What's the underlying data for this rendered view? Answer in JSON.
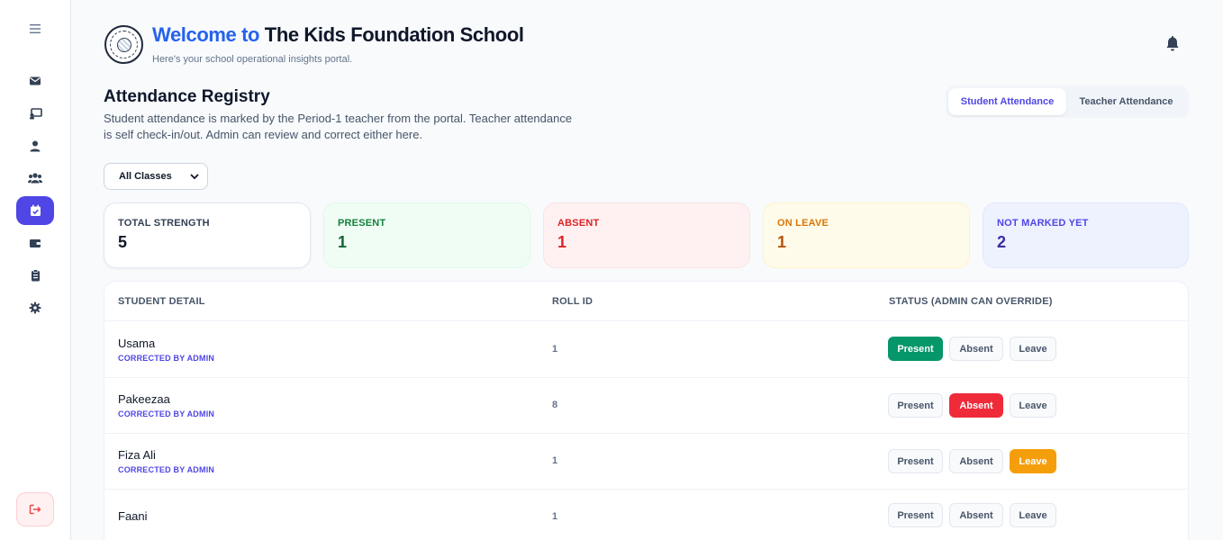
{
  "header": {
    "title_prefix": "Welcome to",
    "title_school": "The Kids Foundation School",
    "subtitle": "Here's your school operational insights portal."
  },
  "sidebar": {
    "items": [
      {
        "icon": "envelope-icon",
        "active": false
      },
      {
        "icon": "chalkboard-icon",
        "active": false
      },
      {
        "icon": "user-icon",
        "active": false
      },
      {
        "icon": "users-icon",
        "active": false
      },
      {
        "icon": "calendar-check-icon",
        "active": true
      },
      {
        "icon": "wallet-icon",
        "active": false
      },
      {
        "icon": "clipboard-icon",
        "active": false
      },
      {
        "icon": "gear-icon",
        "active": false
      }
    ]
  },
  "registry": {
    "title": "Attendance Registry",
    "description": "Student attendance is marked by the Period-1 teacher from the portal. Teacher attendance is self check-in/out. Admin can review and correct either here."
  },
  "tabs": [
    {
      "label": "Student Attendance",
      "active": true
    },
    {
      "label": "Teacher Attendance",
      "active": false
    }
  ],
  "filter": {
    "selected": "All Classes"
  },
  "stats": {
    "total": {
      "label": "TOTAL STRENGTH",
      "value": "5"
    },
    "present": {
      "label": "PRESENT",
      "value": "1"
    },
    "absent": {
      "label": "ABSENT",
      "value": "1"
    },
    "leave": {
      "label": "ON LEAVE",
      "value": "1"
    },
    "not_marked": {
      "label": "NOT MARKED YET",
      "value": "2"
    }
  },
  "table": {
    "headers": {
      "student": "STUDENT DETAIL",
      "roll": "ROLL ID",
      "status": "STATUS (ADMIN CAN OVERRIDE)"
    },
    "button_labels": {
      "present": "Present",
      "absent": "Absent",
      "leave": "Leave"
    },
    "rows": [
      {
        "name": "Usama",
        "note": "CORRECTED BY ADMIN",
        "roll": "1",
        "status": "present"
      },
      {
        "name": "Pakeezaa",
        "note": "CORRECTED BY ADMIN",
        "roll": "8",
        "status": "absent"
      },
      {
        "name": "Fiza Ali",
        "note": "CORRECTED BY ADMIN",
        "roll": "1",
        "status": "leave"
      },
      {
        "name": "Faani",
        "note": "",
        "roll": "1",
        "status": ""
      }
    ]
  },
  "colors": {
    "accent": "#4f46e5",
    "present": "#059669",
    "absent": "#ef2b3a",
    "leave": "#f59e0b"
  }
}
